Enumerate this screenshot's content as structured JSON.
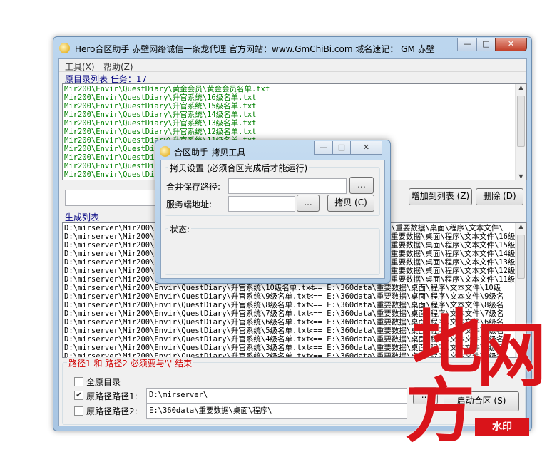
{
  "window": {
    "title": "Hero合区助手  赤壁网络诚信一条龙代理  官方网站：www.GmChiBi.com 域名速记： GM 赤壁",
    "minimize": "—",
    "maximize": "□",
    "close": "✕"
  },
  "menu": {
    "tools": "工具(X)",
    "help": "帮助(Z)"
  },
  "source_list": {
    "label": "原目录列表 任务：17",
    "items": [
      "Mir200\\Envir\\QuestDiary\\黄金会员\\黄金会员名单.txt",
      "Mir200\\Envir\\QuestDiary\\升官系统\\16级名单.txt",
      "Mir200\\Envir\\QuestDiary\\升官系统\\15级名单.txt",
      "Mir200\\Envir\\QuestDiary\\升官系统\\14级名单.txt",
      "Mir200\\Envir\\QuestDiary\\升官系统\\13级名单.txt",
      "Mir200\\Envir\\QuestDiary\\升官系统\\12级名单.txt",
      "Mir200\\Envir\\QuestDiary\\升官系统\\11级名单.txt",
      "Mir200\\Envir\\QuestDia",
      "Mir200\\Envir\\QuestDia",
      "Mir200\\Envir\\QuestDia",
      "Mir200\\Envir\\QuestDia"
    ],
    "add_button": "增加到列表 (Z)",
    "delete_button": "删除 (D)"
  },
  "generated_list": {
    "label": "生成列表",
    "items_left": [
      "D:\\mirserver\\Mir200\\E",
      "D:\\mirserver\\Mir200\\E",
      "D:\\mirserver\\Mir200\\E",
      "D:\\mirserver\\Mir200\\E",
      "D:\\mirserver\\Mir200\\E",
      "D:\\mirserver\\Mir200\\E",
      "D:\\mirserver\\Mir200\\E",
      "D:\\mirserver\\Mir200\\Envir\\QuestDiary\\升官系统\\10级名单.txt",
      "D:\\mirserver\\Mir200\\Envir\\QuestDiary\\升官系统\\9级名单.txt",
      "D:\\mirserver\\Mir200\\Envir\\QuestDiary\\升官系统\\8级名单.txt",
      "D:\\mirserver\\Mir200\\Envir\\QuestDiary\\升官系统\\7级名单.txt",
      "D:\\mirserver\\Mir200\\Envir\\QuestDiary\\升官系统\\6级名单.txt",
      "D:\\mirserver\\Mir200\\Envir\\QuestDiary\\升官系统\\5级名单.txt",
      "D:\\mirserver\\Mir200\\Envir\\QuestDiary\\升官系统\\4级名单.txt",
      "D:\\mirserver\\Mir200\\Envir\\QuestDiary\\升官系统\\3级名单.txt",
      "D:\\mirserver\\Mir200\\Envir\\QuestDiary\\升官系统\\2级名单.txt"
    ],
    "items_right": [
      "\\重要数据\\桌面\\程序\\文本文件\\",
      "重要数据\\桌面\\程序\\文本文件\\16级",
      "重要数据\\桌面\\程序\\文本文件\\15级",
      "重要数据\\桌面\\程序\\文本文件\\14级",
      "重要数据\\桌面\\程序\\文本文件\\13级",
      "重要数据\\桌面\\程序\\文本文件\\12级",
      "重要数据\\桌面\\程序\\文本文件\\11级",
      "<== E:\\360data\\重要数据\\桌面\\程序\\文本文件\\10级",
      "<== E:\\360data\\重要数据\\桌面\\程序\\文本文件\\9级名",
      "<== E:\\360data\\重要数据\\桌面\\程序\\文本文件\\8级名",
      "<== E:\\360data\\重要数据\\桌面\\程序\\文本文件\\7级名",
      "<== E:\\360data\\重要数据\\桌面\\程序\\文本文件\\6级名",
      "<== E:\\360data\\重要数据\\桌面\\程序\\文本文件\\5级名",
      "<== E:\\360data\\重要数据\\桌面\\程序\\文本文件\\4级名",
      "<== E:\\360data\\重要数据\\桌面\\程序\\文本文件\\3级名",
      "<== E:\\360data\\重要数据\\桌面\\程序\\文本文件\\2级名"
    ]
  },
  "path_note": "路径1 和 路径2 必须要与'\\' 结束",
  "options": {
    "all_dirs": "全原目录",
    "path1_label": "原路径路径1:",
    "path1_value": "D:\\mirserver\\",
    "path2_label": "原路径路径2:",
    "path2_value": "E:\\360data\\重要数据\\桌面\\程序\\",
    "browse": "...",
    "start_button": "启动合区 (S)"
  },
  "dialog": {
    "title": "合区助手-拷贝工具",
    "group_title": "拷贝设置 (必须合区完成后才能运行)",
    "merge_path_label": "合并保存路径:",
    "server_addr_label": "服务端地址:",
    "browse": "...",
    "copy_button": "拷贝 (C)",
    "status_label": "状态:",
    "minimize": "—",
    "maximize": "□",
    "close": "✕"
  },
  "watermark": {
    "chars": [
      "地",
      "网",
      "方"
    ],
    "stamp": "水印"
  },
  "colors": {
    "accent_green": "#008000",
    "label_navy": "#000080",
    "watermark_red": "#d9141a"
  }
}
